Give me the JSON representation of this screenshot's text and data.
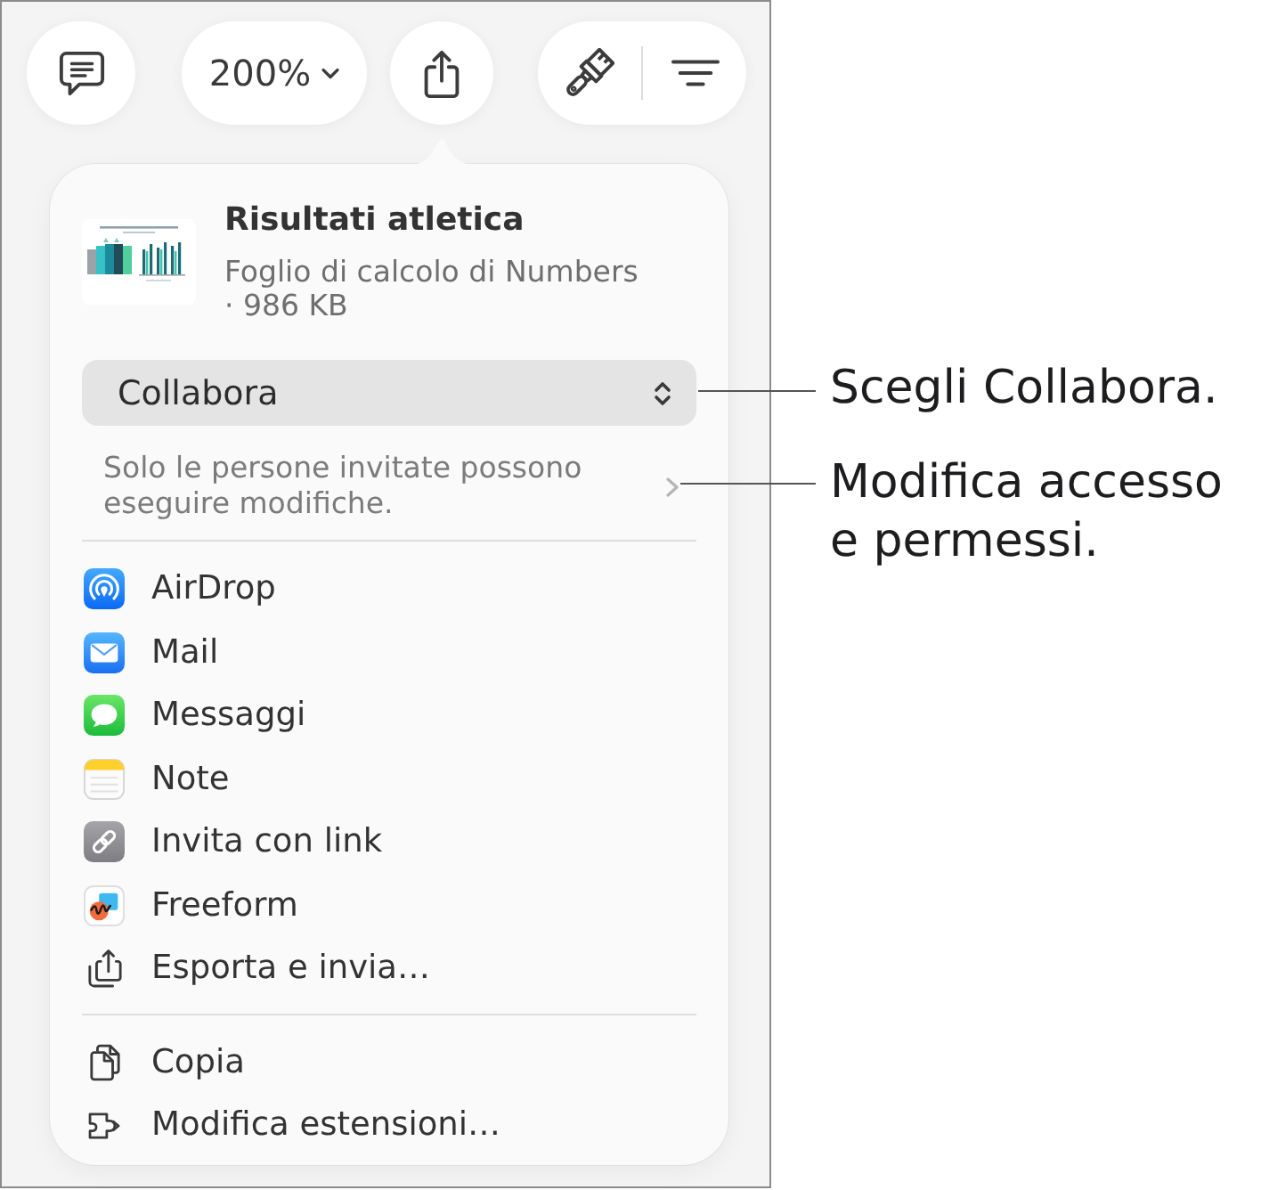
{
  "toolbar": {
    "zoom": "200%"
  },
  "share_sheet": {
    "file": {
      "title": "Risultati atletica",
      "type": "Foglio di calcolo di Numbers",
      "size": "· 986 KB"
    },
    "mode_select": {
      "value": "Collabora"
    },
    "access_note": "Solo le persone invitate possono eseguire modifiche.",
    "share_options": [
      {
        "label": "AirDrop",
        "kind": "airdrop"
      },
      {
        "label": "Mail",
        "kind": "mail"
      },
      {
        "label": "Messaggi",
        "kind": "messages"
      },
      {
        "label": "Note",
        "kind": "notes"
      },
      {
        "label": "Invita con link",
        "kind": "link"
      },
      {
        "label": "Freeform",
        "kind": "freeform"
      },
      {
        "label": "Esporta e invia…",
        "kind": "export"
      }
    ],
    "actions": [
      {
        "label": "Copia",
        "kind": "copy"
      },
      {
        "label": "Modifica estensioni…",
        "kind": "extensions"
      }
    ]
  },
  "callouts": [
    {
      "text": "Scegli Collabora."
    },
    {
      "text": "Modifica accesso e permessi."
    }
  ]
}
